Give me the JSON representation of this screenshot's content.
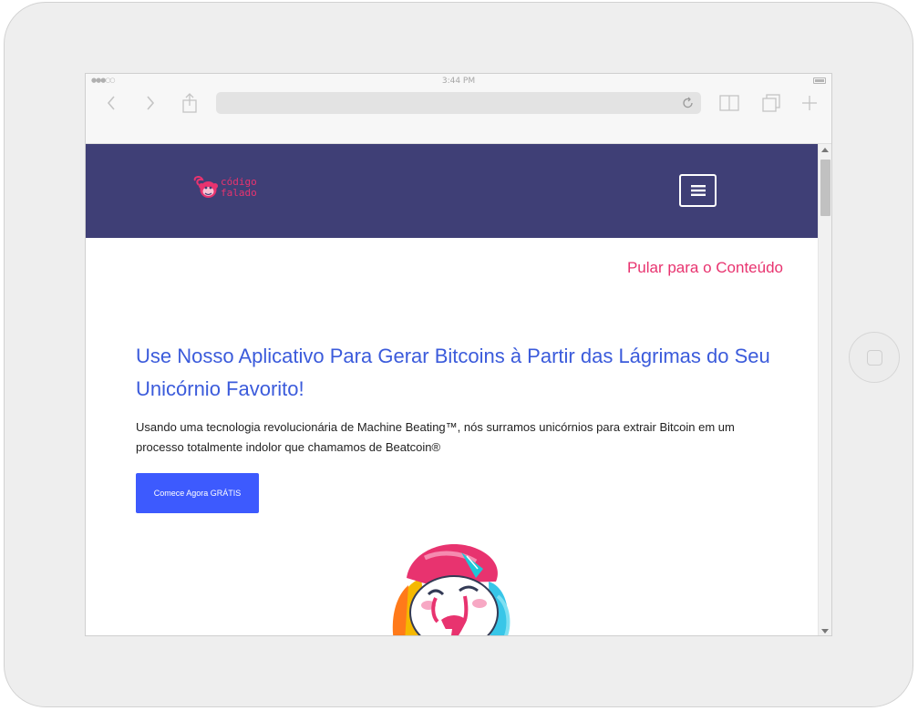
{
  "device": {
    "status_bar": {
      "time": "3:44 PM",
      "signal": "●●●○○"
    }
  },
  "site": {
    "logo": {
      "line1": "código",
      "line2": "falado"
    },
    "skip_link": "Pular para o Conteúdo",
    "hero": {
      "title": "Use Nosso Aplicativo Para Gerar Bitcoins à Partir das Lágrimas do Seu Unicórnio Favorito!",
      "description": "Usando uma tecnologia revolucionária de Machine Beating™, nós surramos unicórnios para extrair Bitcoin em um processo totalmente indolor que chamamos de Beatcoin®",
      "cta_label": "Comece Agora GRÁTIS"
    },
    "colors": {
      "header_bg": "#3f3f76",
      "accent_pink": "#e8336f",
      "title_blue": "#3b5bdb",
      "button_blue": "#3d5afe"
    }
  }
}
